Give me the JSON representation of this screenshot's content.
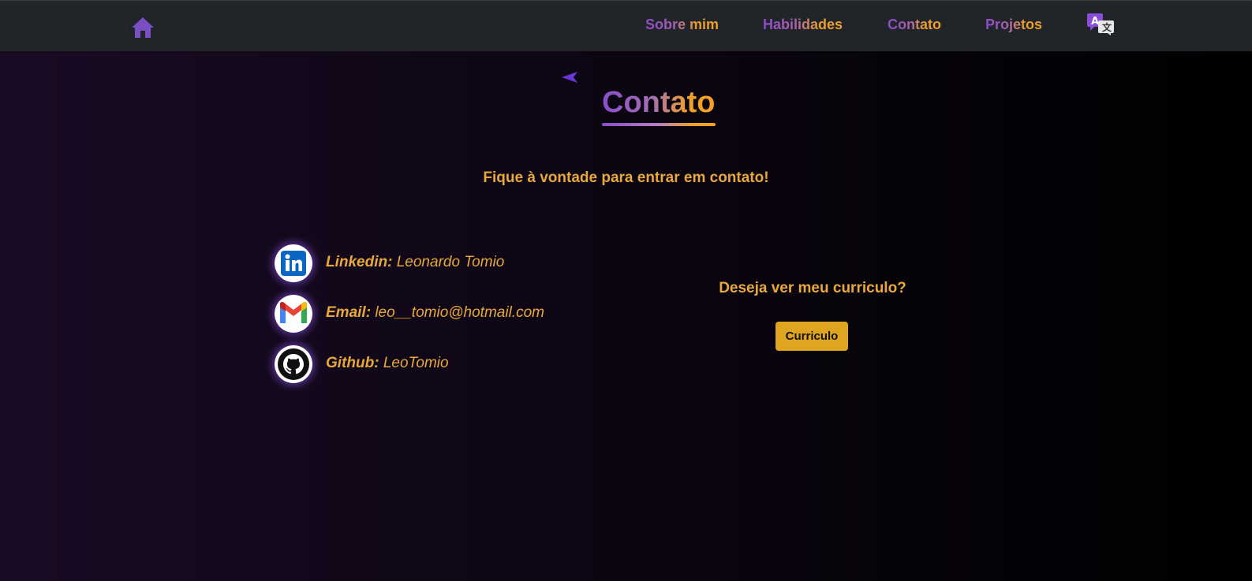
{
  "nav": {
    "home_icon": "home-icon",
    "links": [
      {
        "label": "Sobre mim"
      },
      {
        "label": "Habilidades"
      },
      {
        "label": "Contato"
      },
      {
        "label": "Projetos"
      }
    ],
    "translate_icon": "translate-icon"
  },
  "main": {
    "back_icon": "back-arrow-icon",
    "title": "Contato",
    "subtitle": "Fique à vontade para entrar em contato!",
    "contacts": [
      {
        "label": "Linkedin:",
        "value": "Leonardo Tomio",
        "icon": "linkedin-icon"
      },
      {
        "label": "Email:",
        "value": "leo__tomio@hotmail.com",
        "icon": "gmail-icon"
      },
      {
        "label": "Github:",
        "value": "LeoTomio",
        "icon": "github-icon"
      }
    ],
    "cv_question": "Deseja ver meu curriculo?",
    "cv_button": "Curriculo"
  },
  "colors": {
    "accent_orange": "#e8a93a",
    "accent_purple": "#8a4dc9",
    "button_bg": "#dfa521",
    "navbar_bg": "#212429"
  }
}
